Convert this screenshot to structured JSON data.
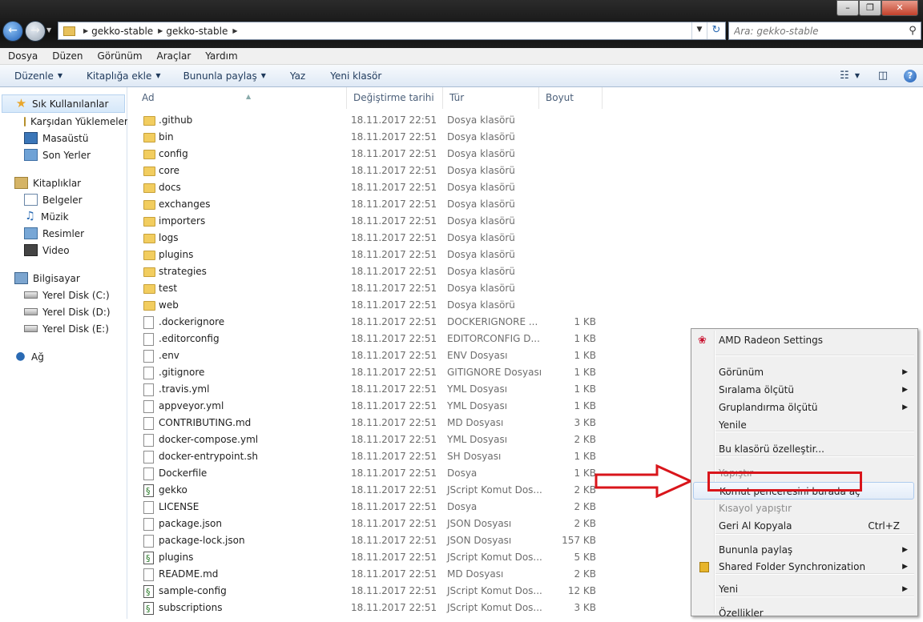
{
  "address": {
    "crumbs": [
      "gekko-stable",
      "gekko-stable"
    ]
  },
  "search": {
    "placeholder": "Ara: gekko-stable"
  },
  "menubar": [
    "Dosya",
    "Düzen",
    "Görünüm",
    "Araçlar",
    "Yardım"
  ],
  "toolbar": {
    "organize": "Düzenle",
    "add_library": "Kitaplığa ekle",
    "share": "Bununla paylaş",
    "burn": "Yaz",
    "new_folder": "Yeni klasör"
  },
  "nav": {
    "favorites": {
      "label": "Sık Kullanılanlar",
      "items": [
        "Karşıdan Yüklemeler",
        "Masaüstü",
        "Son Yerler"
      ]
    },
    "libraries": {
      "label": "Kitaplıklar",
      "items": [
        "Belgeler",
        "Müzik",
        "Resimler",
        "Video"
      ]
    },
    "computer": {
      "label": "Bilgisayar",
      "items": [
        "Yerel Disk (C:)",
        "Yerel Disk (D:)",
        "Yerel Disk (E:)"
      ]
    },
    "network": {
      "label": "Ağ"
    }
  },
  "columns": {
    "name": "Ad",
    "date": "Değiştirme tarihi",
    "type": "Tür",
    "size": "Boyut"
  },
  "files": [
    {
      "name": ".github",
      "date": "18.11.2017 22:51",
      "type": "Dosya klasörü",
      "size": "",
      "kind": "folder"
    },
    {
      "name": "bin",
      "date": "18.11.2017 22:51",
      "type": "Dosya klasörü",
      "size": "",
      "kind": "folder"
    },
    {
      "name": "config",
      "date": "18.11.2017 22:51",
      "type": "Dosya klasörü",
      "size": "",
      "kind": "folder"
    },
    {
      "name": "core",
      "date": "18.11.2017 22:51",
      "type": "Dosya klasörü",
      "size": "",
      "kind": "folder"
    },
    {
      "name": "docs",
      "date": "18.11.2017 22:51",
      "type": "Dosya klasörü",
      "size": "",
      "kind": "folder"
    },
    {
      "name": "exchanges",
      "date": "18.11.2017 22:51",
      "type": "Dosya klasörü",
      "size": "",
      "kind": "folder"
    },
    {
      "name": "importers",
      "date": "18.11.2017 22:51",
      "type": "Dosya klasörü",
      "size": "",
      "kind": "folder"
    },
    {
      "name": "logs",
      "date": "18.11.2017 22:51",
      "type": "Dosya klasörü",
      "size": "",
      "kind": "folder"
    },
    {
      "name": "plugins",
      "date": "18.11.2017 22:51",
      "type": "Dosya klasörü",
      "size": "",
      "kind": "folder"
    },
    {
      "name": "strategies",
      "date": "18.11.2017 22:51",
      "type": "Dosya klasörü",
      "size": "",
      "kind": "folder"
    },
    {
      "name": "test",
      "date": "18.11.2017 22:51",
      "type": "Dosya klasörü",
      "size": "",
      "kind": "folder"
    },
    {
      "name": "web",
      "date": "18.11.2017 22:51",
      "type": "Dosya klasörü",
      "size": "",
      "kind": "folder"
    },
    {
      "name": ".dockerignore",
      "date": "18.11.2017 22:51",
      "type": "DOCKERIGNORE ...",
      "size": "1 KB",
      "kind": "file"
    },
    {
      "name": ".editorconfig",
      "date": "18.11.2017 22:51",
      "type": "EDITORCONFIG D...",
      "size": "1 KB",
      "kind": "file"
    },
    {
      "name": ".env",
      "date": "18.11.2017 22:51",
      "type": "ENV Dosyası",
      "size": "1 KB",
      "kind": "file"
    },
    {
      "name": ".gitignore",
      "date": "18.11.2017 22:51",
      "type": "GITIGNORE Dosyası",
      "size": "1 KB",
      "kind": "file"
    },
    {
      "name": ".travis.yml",
      "date": "18.11.2017 22:51",
      "type": "YML Dosyası",
      "size": "1 KB",
      "kind": "file"
    },
    {
      "name": "appveyor.yml",
      "date": "18.11.2017 22:51",
      "type": "YML Dosyası",
      "size": "1 KB",
      "kind": "file"
    },
    {
      "name": "CONTRIBUTING.md",
      "date": "18.11.2017 22:51",
      "type": "MD Dosyası",
      "size": "3 KB",
      "kind": "file"
    },
    {
      "name": "docker-compose.yml",
      "date": "18.11.2017 22:51",
      "type": "YML Dosyası",
      "size": "2 KB",
      "kind": "file"
    },
    {
      "name": "docker-entrypoint.sh",
      "date": "18.11.2017 22:51",
      "type": "SH Dosyası",
      "size": "1 KB",
      "kind": "file"
    },
    {
      "name": "Dockerfile",
      "date": "18.11.2017 22:51",
      "type": "Dosya",
      "size": "1 KB",
      "kind": "file"
    },
    {
      "name": "gekko",
      "date": "18.11.2017 22:51",
      "type": "JScript Komut Dos...",
      "size": "2 KB",
      "kind": "script"
    },
    {
      "name": "LICENSE",
      "date": "18.11.2017 22:51",
      "type": "Dosya",
      "size": "2 KB",
      "kind": "file"
    },
    {
      "name": "package.json",
      "date": "18.11.2017 22:51",
      "type": "JSON Dosyası",
      "size": "2 KB",
      "kind": "file"
    },
    {
      "name": "package-lock.json",
      "date": "18.11.2017 22:51",
      "type": "JSON Dosyası",
      "size": "157 KB",
      "kind": "file"
    },
    {
      "name": "plugins",
      "date": "18.11.2017 22:51",
      "type": "JScript Komut Dos...",
      "size": "5 KB",
      "kind": "script"
    },
    {
      "name": "README.md",
      "date": "18.11.2017 22:51",
      "type": "MD Dosyası",
      "size": "2 KB",
      "kind": "file"
    },
    {
      "name": "sample-config",
      "date": "18.11.2017 22:51",
      "type": "JScript Komut Dos...",
      "size": "12 KB",
      "kind": "script"
    },
    {
      "name": "subscriptions",
      "date": "18.11.2017 22:51",
      "type": "JScript Komut Dos...",
      "size": "3 KB",
      "kind": "script"
    }
  ],
  "context_menu": [
    {
      "label": "AMD Radeon Settings",
      "icon": "amd-icon",
      "submenu": false
    },
    {
      "sep": true
    },
    {
      "label": "Görünüm",
      "submenu": true
    },
    {
      "label": "Sıralama ölçütü",
      "submenu": true
    },
    {
      "label": "Gruplandırma ölçütü",
      "submenu": true
    },
    {
      "label": "Yenile",
      "submenu": false
    },
    {
      "sep": true
    },
    {
      "label": "Bu klasörü özelleştir...",
      "submenu": false
    },
    {
      "sep": true
    },
    {
      "label": "Yapıştır",
      "disabled": true
    },
    {
      "label": "Komut penceresini burada aç",
      "highlight": true
    },
    {
      "label": "Kısayol yapıştır",
      "disabled": true
    },
    {
      "label": "Geri Al Kopyala",
      "shortcut": "Ctrl+Z"
    },
    {
      "sep": true
    },
    {
      "label": "Bununla paylaş",
      "submenu": true
    },
    {
      "label": "Shared Folder Synchronization",
      "icon": "sync-icon",
      "submenu": true
    },
    {
      "sep": true
    },
    {
      "label": "Yeni",
      "submenu": true
    },
    {
      "sep": true
    },
    {
      "label": "Özellikler",
      "submenu": false
    }
  ],
  "annotation": {
    "color": "#d9151b"
  }
}
